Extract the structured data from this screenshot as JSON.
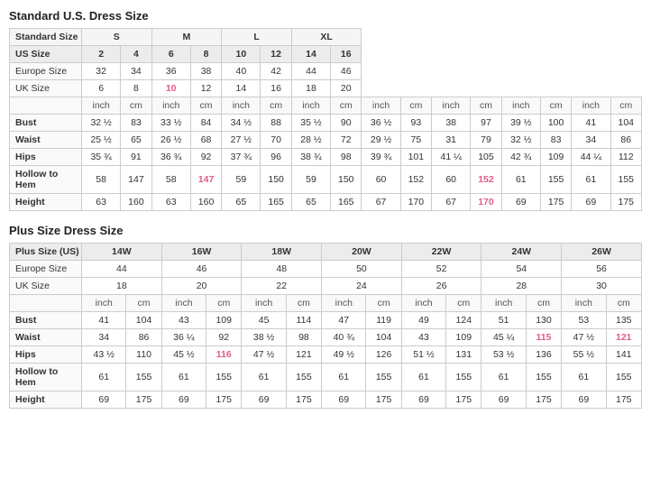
{
  "standard": {
    "title": "Standard U.S. Dress Size",
    "sizeGroups": [
      {
        "label": "Standard Size",
        "cols": [
          "S",
          "M",
          "L",
          "XL"
        ],
        "colspans": [
          2,
          2,
          2,
          2
        ]
      },
      {
        "label": "US Size",
        "values": [
          "2",
          "4",
          "6",
          "8",
          "10",
          "12",
          "14",
          "16"
        ],
        "pinks": []
      },
      {
        "label": "Europe Size",
        "values": [
          "32",
          "34",
          "36",
          "38",
          "40",
          "42",
          "44",
          "46"
        ],
        "pinks": []
      },
      {
        "label": "UK Size",
        "values": [
          "6",
          "8",
          "10",
          "12",
          "14",
          "16",
          "18",
          "20"
        ],
        "pinks": [
          2,
          3
        ]
      }
    ],
    "subHeader": [
      "inch",
      "cm",
      "inch",
      "cm",
      "inch",
      "cm",
      "inch",
      "cm",
      "inch",
      "cm",
      "inch",
      "cm",
      "inch",
      "cm",
      "inch",
      "cm"
    ],
    "rows": [
      {
        "label": "Bust",
        "values": [
          "32 ½",
          "83",
          "33 ½",
          "84",
          "34 ½",
          "88",
          "35 ½",
          "90",
          "36 ½",
          "93",
          "38",
          "97",
          "39 ½",
          "100",
          "41",
          "104"
        ],
        "pinks": []
      },
      {
        "label": "Waist",
        "values": [
          "25 ½",
          "65",
          "26 ½",
          "68",
          "27 ½",
          "70",
          "28 ½",
          "72",
          "29 ½",
          "75",
          "31",
          "79",
          "32 ½",
          "83",
          "34",
          "86"
        ],
        "pinks": []
      },
      {
        "label": "Hips",
        "values": [
          "35 ¾",
          "91",
          "36 ¾",
          "92",
          "37 ¾",
          "96",
          "38 ¾",
          "98",
          "39 ¾",
          "101",
          "41 ¼",
          "105",
          "42 ¾",
          "109",
          "44 ¼",
          "112"
        ],
        "pinks": []
      },
      {
        "label": "Hollow to Hem",
        "values": [
          "58",
          "147",
          "58",
          "147",
          "59",
          "150",
          "59",
          "150",
          "60",
          "152",
          "60",
          "152",
          "61",
          "155",
          "61",
          "155"
        ],
        "pinks": [
          5,
          11
        ]
      },
      {
        "label": "Height",
        "values": [
          "63",
          "160",
          "63",
          "160",
          "65",
          "165",
          "65",
          "165",
          "67",
          "170",
          "67",
          "170",
          "69",
          "175",
          "69",
          "175"
        ],
        "pinks": [
          5,
          11
        ]
      }
    ]
  },
  "plus": {
    "title": "Plus Size Dress Size",
    "sizeGroups": [
      {
        "label": "Plus Size (US)",
        "values": [
          "14W",
          "16W",
          "18W",
          "20W",
          "22W",
          "24W",
          "26W"
        ],
        "pinks": []
      },
      {
        "label": "Europe Size",
        "values": [
          "44",
          "46",
          "48",
          "50",
          "52",
          "54",
          "56"
        ],
        "pinks": []
      },
      {
        "label": "UK Size",
        "values": [
          "18",
          "20",
          "22",
          "24",
          "26",
          "28",
          "30"
        ],
        "pinks": []
      }
    ],
    "subHeader": [
      "inch",
      "cm",
      "inch",
      "cm",
      "inch",
      "cm",
      "inch",
      "cm",
      "inch",
      "cm",
      "inch",
      "cm",
      "inch",
      "cm"
    ],
    "rows": [
      {
        "label": "Bust",
        "values": [
          "41",
          "104",
          "43",
          "109",
          "45",
          "114",
          "47",
          "119",
          "49",
          "124",
          "51",
          "130",
          "53",
          "135"
        ],
        "pinks": []
      },
      {
        "label": "Waist",
        "values": [
          "34",
          "86",
          "36 ¼",
          "92",
          "38 ½",
          "98",
          "40 ¾",
          "104",
          "43",
          "109",
          "45 ¼",
          "115",
          "47 ½",
          "121"
        ],
        "pinks": [
          11,
          13
        ]
      },
      {
        "label": "Hips",
        "values": [
          "43 ½",
          "110",
          "45 ½",
          "116",
          "47 ½",
          "121",
          "49 ½",
          "126",
          "51 ½",
          "131",
          "53 ½",
          "136",
          "55 ½",
          "141"
        ],
        "pinks": [
          3,
          13
        ]
      },
      {
        "label": "Hollow to Hem",
        "values": [
          "61",
          "155",
          "61",
          "155",
          "61",
          "155",
          "61",
          "155",
          "61",
          "155",
          "61",
          "155",
          "61",
          "155"
        ],
        "pinks": []
      },
      {
        "label": "Height",
        "values": [
          "69",
          "175",
          "69",
          "175",
          "69",
          "175",
          "69",
          "175",
          "69",
          "175",
          "69",
          "175",
          "69",
          "175"
        ],
        "pinks": []
      }
    ]
  }
}
